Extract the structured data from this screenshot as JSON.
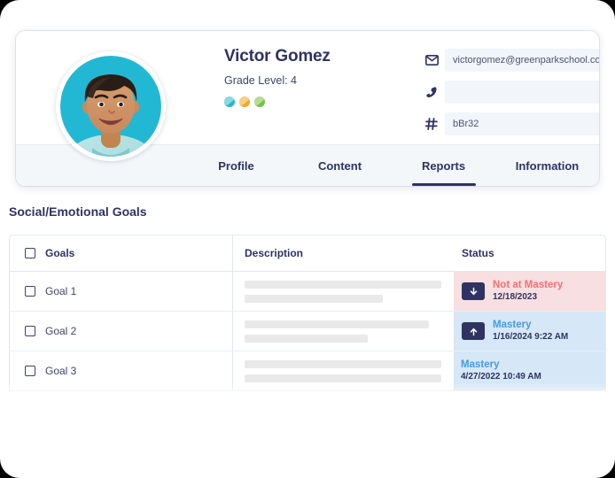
{
  "profile": {
    "name": "Victor Gomez",
    "grade_label": "Grade Level: 4",
    "avatar_alt": "student-photo",
    "badges": [
      {
        "name": "badge-teal",
        "color": "#28b8c8"
      },
      {
        "name": "badge-orange",
        "color": "#f5a623"
      },
      {
        "name": "badge-green",
        "color": "#78c043"
      }
    ],
    "contacts": [
      {
        "icon": "envelope-icon",
        "value": "victorgomez@greenparkschool.com",
        "empty": false
      },
      {
        "icon": "phone-icon",
        "value": "",
        "empty": true
      },
      {
        "icon": "hash-icon",
        "value": "bBr32",
        "empty": false
      }
    ]
  },
  "tabs": [
    {
      "label": "Profile",
      "active": false
    },
    {
      "label": "Content",
      "active": false
    },
    {
      "label": "Reports",
      "active": true
    },
    {
      "label": "Information",
      "active": false
    }
  ],
  "section": {
    "title": "Social/Emotional Goals"
  },
  "table": {
    "headers": {
      "goals": "Goals",
      "description": "Description",
      "status": "Status"
    },
    "rows": [
      {
        "goal": "Goal 1",
        "desc_bars": [
          94,
          66
        ],
        "status_label": "Not at Mastery",
        "status_date": "12/18/2023",
        "status_tone": "notmastery",
        "row_bg": "st-red",
        "arrow": "down",
        "has_badge": true
      },
      {
        "goal": "Goal 2",
        "desc_bars": [
          88,
          59
        ],
        "status_label": "Mastery",
        "status_date": "1/16/2024 9:22 AM",
        "status_tone": "mastery",
        "row_bg": "st-blue",
        "arrow": "up",
        "has_badge": true
      },
      {
        "goal": "Goal 3",
        "desc_bars": [
          94,
          94
        ],
        "status_label": "Mastery",
        "status_date": "4/27/2022 10:49 AM",
        "status_tone": "mastery",
        "row_bg": "st-blue",
        "arrow": "none",
        "has_badge": false
      }
    ]
  },
  "colors": {
    "navy": "#2e3362",
    "mastery": "#489ae0",
    "not_mastery": "#f1736f",
    "status_red_bg": "#f8dfe1",
    "status_blue_bg": "#d6e7f7",
    "avatar_bg": "#22b8d4"
  }
}
